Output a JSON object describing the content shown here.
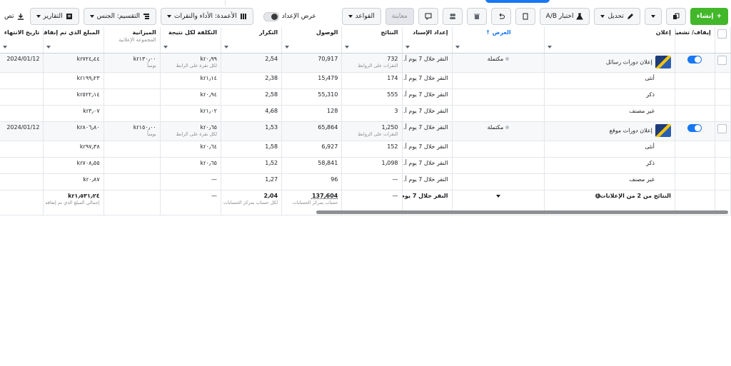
{
  "toolbar": {
    "create_label": "إنشاء",
    "edit_label": "تحديل",
    "ab_test_label": "اختبار A/B",
    "preview_label": "معاينة",
    "rules_label": "القواعد",
    "display_setup_label": "عرض الإعداد",
    "columns_label": "الأعمدة: الأداء والنقرات",
    "breakdown_label": "التقسيم: الجنس",
    "reports_label": "التقارير",
    "export_label": "تص"
  },
  "headers": {
    "toggle": "إيقاف/ تشغيل",
    "ad": "إعلان",
    "delivery": "العرض",
    "attribution": "إعداد الإسناد",
    "results": "النتائج",
    "reach": "الوصول",
    "frequency": "التكرار",
    "cost_per_result": "التكلفة لكل نتيجة",
    "budget": "الميزانية",
    "budget_sub": "المجموعة الإعلانية",
    "amount_spent": "المبلغ الذي تم إنفاقه",
    "end_date": "تاريخ الانتهاء"
  },
  "rows": [
    {
      "ad": "إعلان دورات رسائل",
      "delivery": "مكتملة",
      "attribution": "النقر خلال 7 يوم أ...",
      "results": "732",
      "results_sub": "النقرات على الروابط",
      "reach": "70٫917",
      "frequency": "2٫54",
      "cost": "kr٠٫٩٩",
      "cost_sub": "لكل نقرة على الرابط",
      "budget": "kr١٣٠٫٠٠",
      "budget_sub": "يومياً",
      "spent": "kr٧٢٤٫٤٤",
      "end": "2024/01/12"
    },
    {
      "ad": "أنثى",
      "attribution": "النقر خلال 7 يوم أ...",
      "results": "174",
      "reach": "15٫479",
      "frequency": "2٫38",
      "cost": "kr١٫١٤",
      "spent": "kr١٩٩٫٢٣"
    },
    {
      "ad": "ذكر",
      "attribution": "النقر خلال 7 يوم أ...",
      "results": "555",
      "reach": "55٫310",
      "frequency": "2٫58",
      "cost": "kr٠٫٩٤",
      "spent": "kr٥٢٢٫١٤"
    },
    {
      "ad": "غير مصنف",
      "attribution": "النقر خلال 7 يوم أ...",
      "results": "3",
      "reach": "128",
      "frequency": "4٫68",
      "cost": "kr١٫٠٢",
      "spent": "kr٣٫٠٧"
    },
    {
      "ad": "إعلان دورات موقع",
      "delivery": "مكتملة",
      "attribution": "النقر خلال 7 يوم أ...",
      "results": "1٫250",
      "results_sub": "النقرات على الروابط",
      "reach": "65٫864",
      "frequency": "1٫53",
      "cost": "kr٠٫٦٥",
      "cost_sub": "لكل نقرة على الرابط",
      "budget": "kr١٥٠٫٠٠",
      "budget_sub": "يومياً",
      "spent": "kr٨٠٦٫٨٠",
      "end": "2024/01/12"
    },
    {
      "ad": "أنثى",
      "attribution": "النقر خلال 7 يوم أ...",
      "results": "152",
      "reach": "6٫927",
      "frequency": "1٫58",
      "cost": "kr٠٫٦٤",
      "spent": "kr٩٧٫٣٨"
    },
    {
      "ad": "ذكر",
      "attribution": "النقر خلال 7 يوم أ...",
      "results": "1٫098",
      "reach": "58٫841",
      "frequency": "1٫52",
      "cost": "kr٠٫٦٥",
      "spent": "kr٧٠٨٫٥٥"
    },
    {
      "ad": "غير مصنف",
      "attribution": "النقر خلال 7 يوم أ...",
      "results": "—",
      "reach": "96",
      "frequency": "1٫27",
      "cost": "—",
      "spent": "kr٠٫٨٧"
    }
  ],
  "total": {
    "label": "النتائج من 2 من الإعلانات",
    "attribution": "النقر خلال 7 يوم أ...",
    "results": "—",
    "reach": "137٫604",
    "reach_sub": "حساب بمركز الحسابات",
    "frequency": "2٫04",
    "frequency_sub": "لكل حساب بمركز الحسابات",
    "cost": "—",
    "spent": "kr١٫٥٣١٫٢٤",
    "spent_sub": "إجمالي المبلغ الذي تم إنفاقه"
  }
}
